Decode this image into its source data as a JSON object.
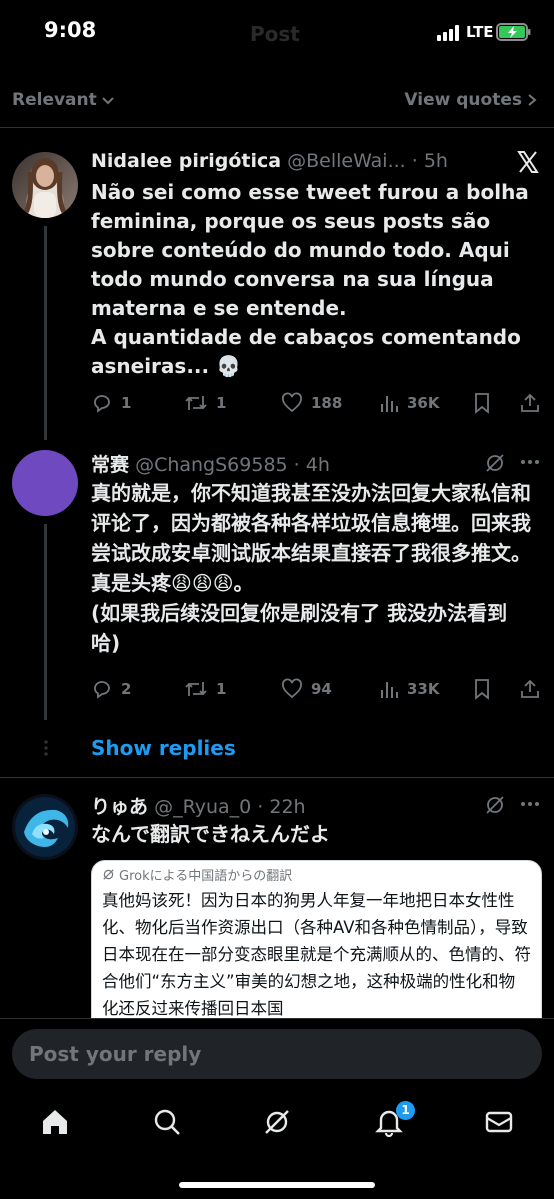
{
  "status_bar": {
    "time": "9:08",
    "ghost_title": "Post",
    "network": "LTE"
  },
  "filter": {
    "sort_label": "Relevant",
    "view_quotes_label": "View quotes"
  },
  "tweets": [
    {
      "name": "Nidalee pirigótica",
      "handle": "@BelleWai...",
      "time": "· 5h",
      "text": "Não sei como esse tweet furou a bolha feminina, porque os seus posts são sobre conteúdo do mundo todo. Aqui todo mundo conversa na sua língua materna e se entende.\nA quantidade de cabaços comentando asneiras... 💀",
      "replies": "1",
      "reposts": "1",
      "likes": "188",
      "views": "36K"
    },
    {
      "name": "常赛",
      "handle": "@ChangS69585",
      "time": "· 4h",
      "text": "真的就是，你不知道我甚至没办法回复大家私信和评论了，因为都被各种各样垃圾信息掩埋。回来我尝试改成安卓测试版本结果直接吞了我很多推文。真是头疼😩😩😩。\n(如果我后续没回复你是刷没有了 我没办法看到哈)",
      "replies": "2",
      "reposts": "1",
      "likes": "94",
      "views": "33K"
    },
    {
      "name": "りゅあ",
      "handle": "@_Ryua_0",
      "time": "· 22h",
      "text": "なんで翻訳できねえんだよ",
      "translation_label": "Grokによる中国語からの翻訳",
      "translation_text": "真他妈该死！因为日本的狗男人年复一年地把日本女性性化、物化后当作资源出口（各种AV和各种色情制品），导致日本现在在一部分变态眼里就是个充满顺从的、色情的、符合他们“东方主义”审美的幻想之地，这种极端的性化和物化还反过来传播回日本国"
    }
  ],
  "show_replies_label": "Show replies",
  "reply_placeholder": "Post your reply",
  "nav": {
    "notifications_badge": "1"
  },
  "icons": [
    "x-logo-icon",
    "grok-icon",
    "more-icon",
    "reply-icon",
    "repost-icon",
    "like-icon",
    "views-icon",
    "bookmark-icon",
    "share-icon",
    "home-icon",
    "search-icon",
    "grok-nav-icon",
    "bell-icon",
    "mail-icon"
  ],
  "colors": {
    "accent": "#1d9bf0",
    "muted": "#71767b",
    "text": "#e7e9ea",
    "background": "#000000"
  }
}
